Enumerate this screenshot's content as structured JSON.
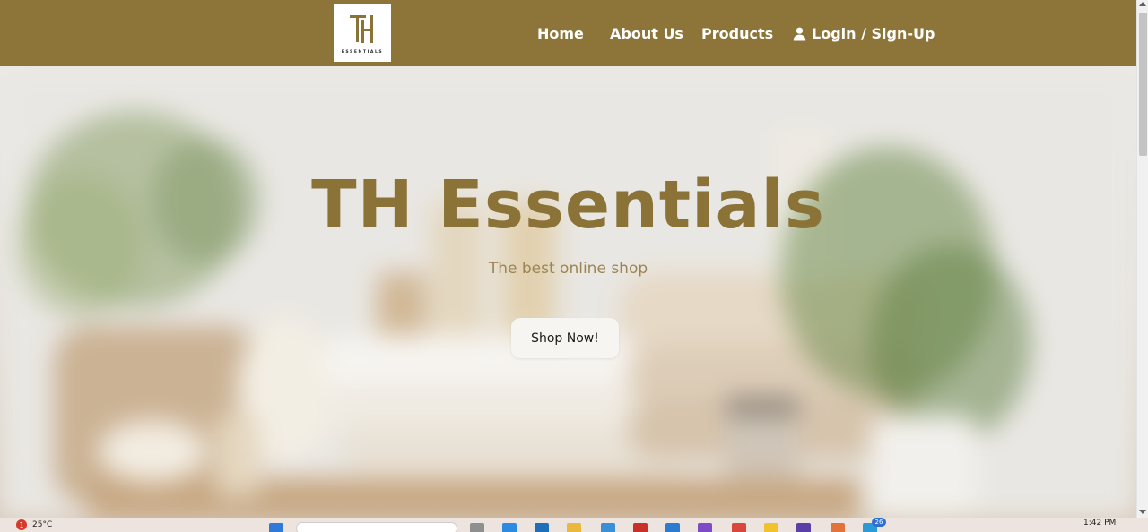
{
  "logo": {
    "text": "ESSENTIALS",
    "monogram": "TH"
  },
  "nav": {
    "home": "Home",
    "about": "About Us",
    "products": "Products",
    "login": "Login / Sign-Up",
    "login_icon": "user-icon"
  },
  "hero": {
    "title": "TH Essentials",
    "subtitle": "The best online shop",
    "cta": "Shop Now!"
  },
  "taskbar": {
    "weather_badge": "1",
    "temperature": "25°C",
    "time": "1:42 PM",
    "notification_count": "26"
  },
  "colors": {
    "brand": "#8d7439",
    "title": "#8b7338",
    "subtitle": "#9b8552"
  }
}
